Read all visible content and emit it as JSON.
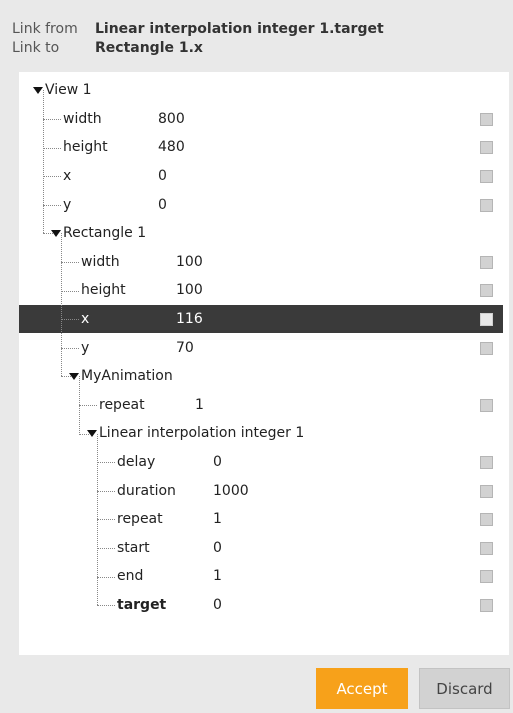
{
  "header": {
    "link_from_label": "Link from",
    "link_from_value": "Linear interpolation integer 1.target",
    "link_to_label": "Link to",
    "link_to_value": "Rectangle 1.x"
  },
  "tree": {
    "view": {
      "name": "View 1",
      "props": [
        {
          "name": "width",
          "value": "800"
        },
        {
          "name": "height",
          "value": "480"
        },
        {
          "name": "x",
          "value": "0"
        },
        {
          "name": "y",
          "value": "0"
        }
      ]
    },
    "rectangle": {
      "name": "Rectangle 1",
      "props": [
        {
          "name": "width",
          "value": "100"
        },
        {
          "name": "height",
          "value": "100"
        },
        {
          "name": "x",
          "value": "116",
          "selected": true
        },
        {
          "name": "y",
          "value": "70"
        }
      ]
    },
    "animation": {
      "name": "MyAnimation",
      "props": [
        {
          "name": "repeat",
          "value": "1"
        }
      ]
    },
    "interpolation": {
      "name": "Linear interpolation integer 1",
      "props": [
        {
          "name": "delay",
          "value": "0"
        },
        {
          "name": "duration",
          "value": "1000"
        },
        {
          "name": "repeat",
          "value": "1"
        },
        {
          "name": "start",
          "value": "0"
        },
        {
          "name": "end",
          "value": "1"
        },
        {
          "name": "target",
          "value": "0",
          "bold": true
        }
      ]
    }
  },
  "buttons": {
    "accept": "Accept",
    "discard": "Discard"
  },
  "colors": {
    "accent": "#f7a11a",
    "selected_row": "#3a3a3a",
    "background": "#e9e9e9"
  }
}
